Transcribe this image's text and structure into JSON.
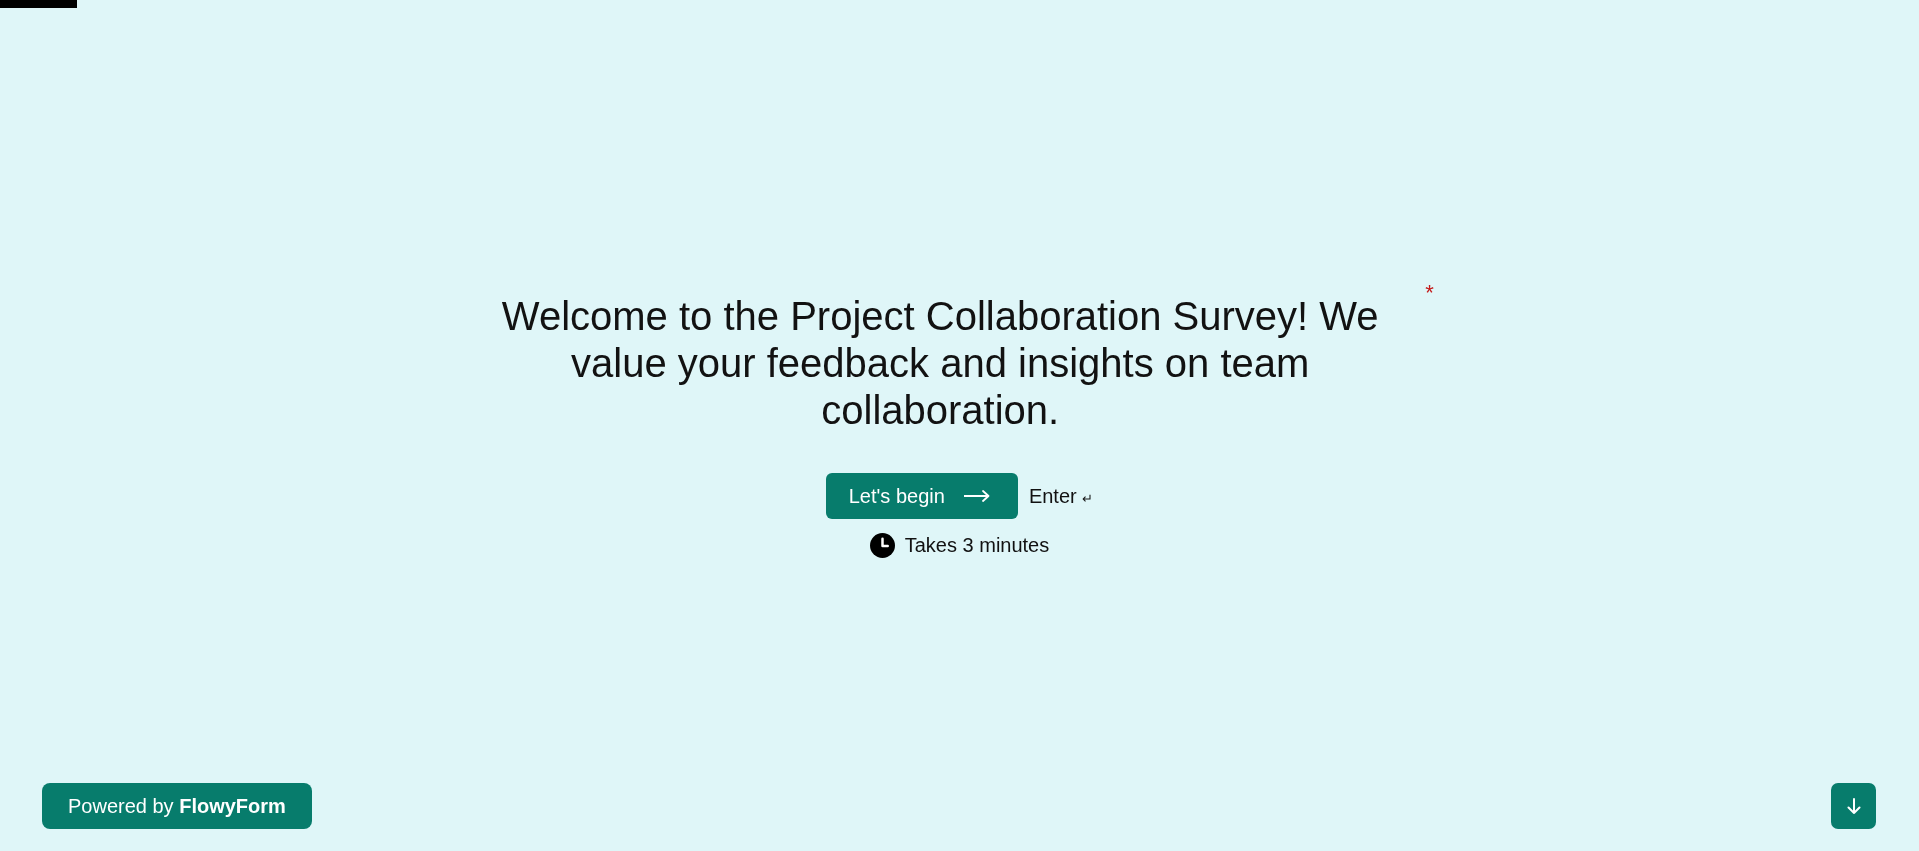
{
  "progress": {
    "level": 0.04
  },
  "welcome": {
    "heading": "Welcome to the Project Collaboration Survey! We value your feedback and insights on team collaboration.",
    "required_mark": "*"
  },
  "start_button": {
    "label": "Let's begin"
  },
  "key_hint": {
    "label": "Enter",
    "symbol": "↵"
  },
  "duration": {
    "text": "Takes 3 minutes"
  },
  "branding": {
    "text": "Powered by **FlowyForm**"
  }
}
